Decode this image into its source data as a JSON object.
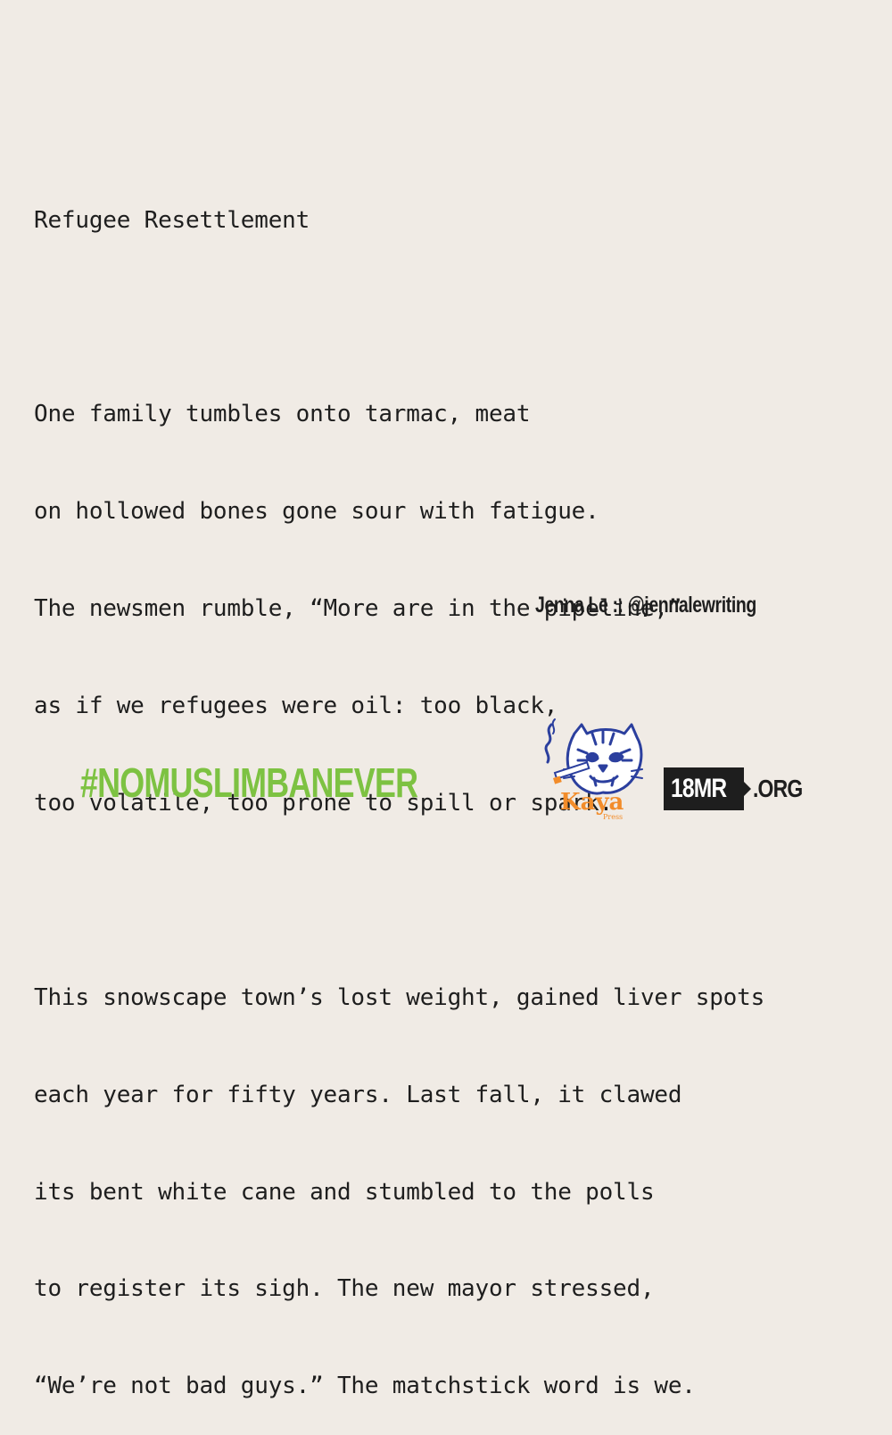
{
  "poem": {
    "title": "Refugee Resettlement",
    "stanza1": [
      "One family tumbles onto tarmac, meat",
      "on hollowed bones gone sour with fatigue.",
      "The newsmen rumble, “More are in the pipeline,”",
      "as if we refugees were oil: too black,",
      "too volatile, too prone to spill or spark."
    ],
    "stanza2": [
      "This snowscape town’s lost weight, gained liver spots",
      "each year for fifty years. Last fall, it clawed",
      "its bent white cane and stumbled to the polls",
      "to register its sigh. The new mayor stressed,",
      "“We’re not bad guys.” The matchstick word is we."
    ]
  },
  "attribution": "Jenna Le :: @jennalewriting",
  "hashtag": "#NOMUSLIMBANEVER",
  "logos": {
    "kaya": {
      "name": "Kaya",
      "sub": "Press",
      "icon": "tiger-head-icon",
      "color": "#f28c2a",
      "icon_color": "#2b3f9e"
    },
    "mr": {
      "box_text": "18MR",
      "suffix": ".ORG"
    }
  },
  "colors": {
    "background": "#f0ebe5",
    "text": "#1e1e1e",
    "hashtag": "#7dc242"
  }
}
